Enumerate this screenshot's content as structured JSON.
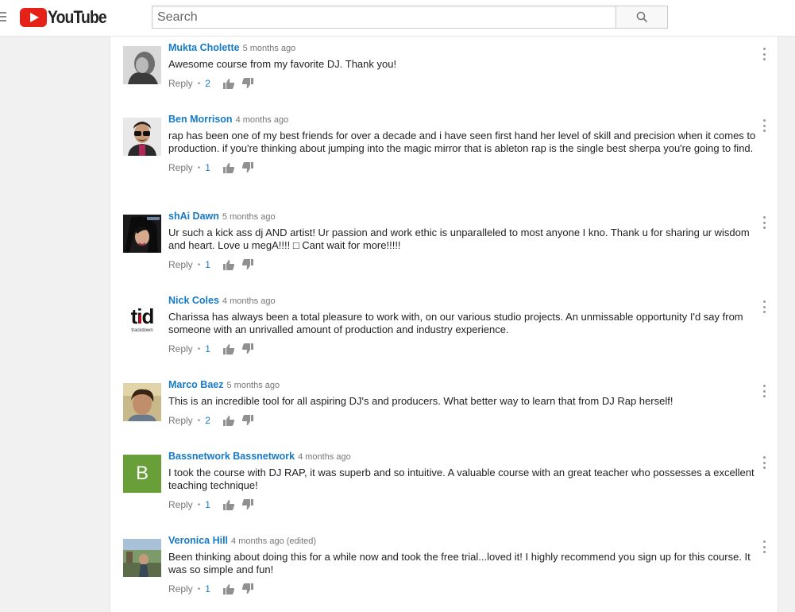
{
  "header": {
    "logo_text": "YouTube",
    "search_placeholder": "Search"
  },
  "comments": [
    {
      "author": "Mukta Cholette",
      "time": "5 months ago",
      "text": "Awesome course from my favorite DJ. Thank you!",
      "reply": "Reply",
      "likes": "2",
      "avatar": "photo"
    },
    {
      "author": "Ben Morrison",
      "time": "4 months ago",
      "text": "rap has been one of my best friends for over a decade and i have seen first hand her level of skill and precision when it comes to production. if you're thinking about jumping into the magic mirror that is ableton rap is the single best sherpa you're going to find.",
      "reply": "Reply",
      "likes": "1",
      "avatar": "photo"
    },
    {
      "author": "shAi Dawn",
      "time": "5 months ago",
      "text": "Ur such a kick ass dj AND artist! Ur passion and work ethic is unparalleled to most anyone I kno. Thank u for sharing ur wisdom and heart. Love u megA!!!! □ Cant wait for more!!!!!",
      "reply": "Reply",
      "likes": "1",
      "avatar": "photo"
    },
    {
      "author": "Nick Coles",
      "time": "4 months ago",
      "text": "Charissa has always been a total pleasure to work with, on our various studio projects. An unmissable opportunity I'd say from someone with an unrivalled amount of production and industry experience.",
      "reply": "Reply",
      "likes": "1",
      "avatar": "tid-logo",
      "avatar_logo": "tid",
      "avatar_logo_sub": "trackdown"
    },
    {
      "author": "Marco Baez",
      "time": "5 months ago",
      "text": "This is an incredible tool for all aspiring DJ's and producers. What better way to learn that from DJ Rap herself!",
      "reply": "Reply",
      "likes": "2",
      "avatar": "photo"
    },
    {
      "author": "Bassnetwork Bassnetwork",
      "time": "4 months ago",
      "text": "I took the course with DJ RAP, it was superb and so intuitive. A valuable course with an great teacher who possesses a excellent teaching technique!",
      "reply": "Reply",
      "likes": "1",
      "avatar": "letter",
      "avatar_letter": "B"
    },
    {
      "author": "Veronica Hill",
      "time": "4 months ago (edited)",
      "text": "Been thinking about doing this for a while now and took the free trial...loved it! I highly recommend you sign up for this course. It was so simple and fun!",
      "reply": "Reply",
      "likes": "1",
      "avatar": "photo"
    }
  ],
  "colors": {
    "brand_red": "#e62117",
    "author_blue": "#167ac6",
    "avatar_green": "#689f38"
  }
}
